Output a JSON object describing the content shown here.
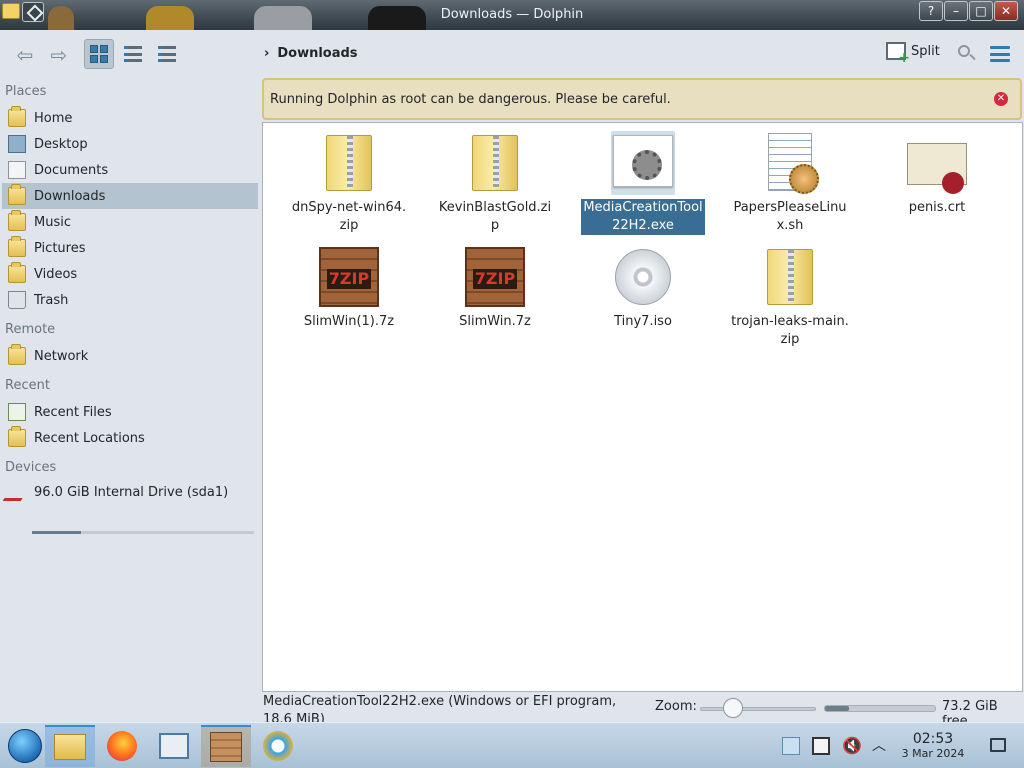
{
  "window": {
    "title": "Downloads — Dolphin"
  },
  "toolbar": {
    "back_icon": "arrow-left-icon",
    "forward_icon": "arrow-right-icon",
    "breadcrumb_sep": "›",
    "breadcrumb": "Downloads",
    "split_label": "Split"
  },
  "banner": {
    "text": "Running Dolphin as root can be dangerous. Please be careful."
  },
  "sidebar": {
    "places_title": "Places",
    "places": [
      "Home",
      "Desktop",
      "Documents",
      "Downloads",
      "Music",
      "Pictures",
      "Videos",
      "Trash"
    ],
    "remote_title": "Remote",
    "remote": [
      "Network"
    ],
    "recent_title": "Recent",
    "recent": [
      "Recent Files",
      "Recent Locations"
    ],
    "devices_title": "Devices",
    "devices": [
      "96.0 GiB Internal Drive (sda1)"
    ],
    "selected": "Downloads",
    "drive_used_fraction": 0.22
  },
  "files": [
    {
      "name": "dnSpy-net-win64.zip",
      "type": "zip"
    },
    {
      "name": "KevinBlastGold.zip",
      "type": "zip"
    },
    {
      "name": "MediaCreationTool22H2.exe",
      "type": "exe",
      "selected": true
    },
    {
      "name": "PapersPleaseLinux.sh",
      "type": "script"
    },
    {
      "name": "penis.crt",
      "type": "certificate"
    },
    {
      "name": "SlimWin(1).7z",
      "type": "7z"
    },
    {
      "name": "SlimWin.7z",
      "type": "7z"
    },
    {
      "name": "Tiny7.iso",
      "type": "iso"
    },
    {
      "name": "trojan-leaks-main.zip",
      "type": "zip"
    }
  ],
  "statusbar": {
    "selection_info": "MediaCreationTool22H2.exe (Windows or EFI program, 18.6 MiB)",
    "zoom_label": "Zoom:",
    "free_space": "73.2 GiB free",
    "free_used_fraction": 0.22
  },
  "taskbar": {
    "time": "02:53",
    "date": "3 Mar 2024"
  },
  "colors": {
    "accent": "#3a6d93",
    "banner_bg": "#e8dfc0",
    "banner_border": "#d7c27e",
    "close_red": "#d42a3f"
  }
}
